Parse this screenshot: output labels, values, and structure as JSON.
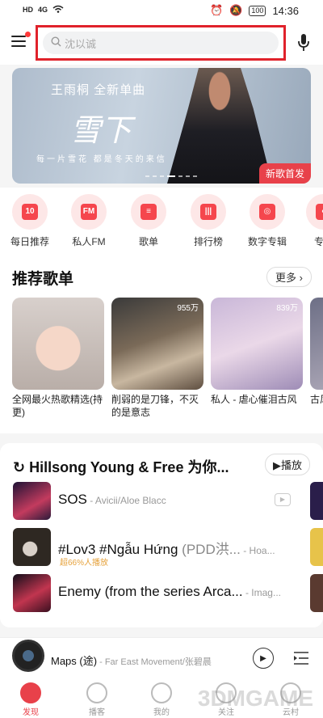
{
  "status_bar": {
    "network": "4G",
    "battery": "100",
    "time": "14:36"
  },
  "search": {
    "placeholder": "沈以诚"
  },
  "banner": {
    "title": "王雨桐  全新单曲",
    "song": "雪下",
    "lyric": "每一片雪花  都是冬天的来信",
    "tag": "新歌首发"
  },
  "quick_entries": [
    {
      "label": "每日推荐",
      "icon_text": "10"
    },
    {
      "label": "私人FM",
      "icon_text": "FM"
    },
    {
      "label": "歌单",
      "icon_text": "≡"
    },
    {
      "label": "排行榜",
      "icon_text": "|||"
    },
    {
      "label": "数字专辑",
      "icon_text": "◎"
    },
    {
      "label": "专注",
      "icon_text": "◐"
    }
  ],
  "recommended": {
    "title": "推荐歌单",
    "more": "更多",
    "playlists": [
      {
        "name": "全网最火热歌精选(持更)",
        "count": ""
      },
      {
        "name": "削弱的是刀锋，不灭的是意志",
        "count": "955万"
      },
      {
        "name": "私人 - 虐心催泪古风",
        "count": "839万"
      },
      {
        "name": "古风...",
        "count": ""
      }
    ]
  },
  "playlist_card": {
    "title": "Hillsong Young & Free 为你...",
    "play_label": "播放",
    "songs": [
      {
        "title": "SOS",
        "artist": " - Avicii/Aloe Blacc",
        "subtitle": "",
        "badge": ""
      },
      {
        "title": "#Lov3 #Ngẫu Hứng",
        "artist": " - Hoa...",
        "subtitle": " (PDD洪...",
        "badge": "超66%人播放"
      },
      {
        "title": "Enemy (from the series Arca...",
        "artist": " - Imag...",
        "subtitle": "",
        "badge": ""
      }
    ]
  },
  "player": {
    "title": "Maps (途)",
    "artist": " - Far East Movement/张碧晨"
  },
  "tabs": [
    {
      "label": "发现",
      "active": true
    },
    {
      "label": "播客",
      "active": false
    },
    {
      "label": "我的",
      "active": false
    },
    {
      "label": "关注",
      "active": false
    },
    {
      "label": "云村",
      "active": false
    }
  ],
  "watermark": "3DMGAME"
}
